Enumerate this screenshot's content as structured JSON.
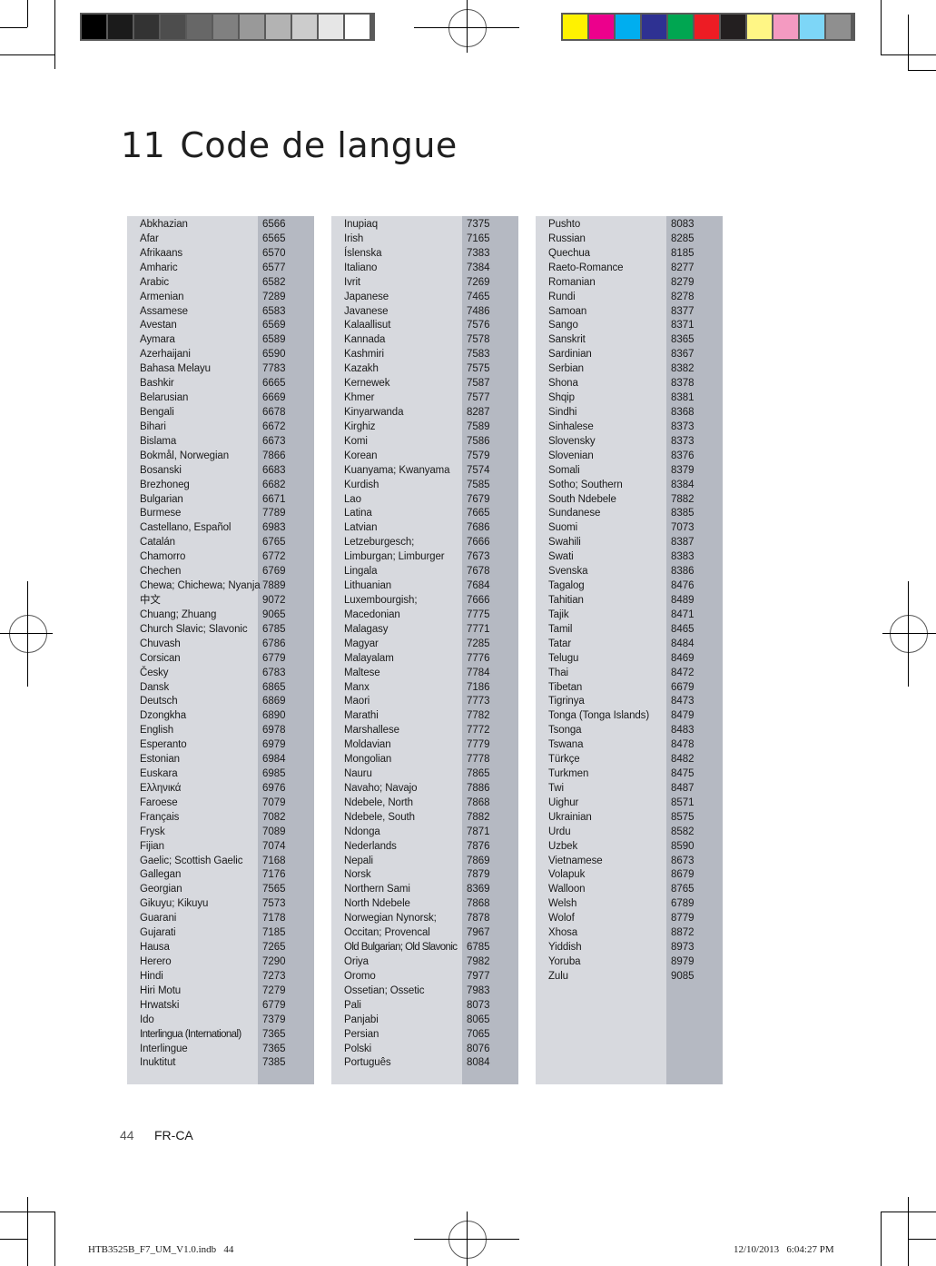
{
  "color_bars": {
    "grayscale": [
      "#000000",
      "#1b1b1b",
      "#333333",
      "#4d4d4d",
      "#676767",
      "#808080",
      "#999999",
      "#b3b3b3",
      "#cccccc",
      "#e6e6e6",
      "#ffffff"
    ],
    "process": [
      "#fff200",
      "#ec008c",
      "#00aeef",
      "#2e3192",
      "#00a651",
      "#ed1c24",
      "#231f20",
      "#fff685",
      "#f49ac1",
      "#7dd6f7",
      "#8f8f8f"
    ]
  },
  "title": {
    "number": "11",
    "text": "Code de langue"
  },
  "columns": [
    {
      "rows": [
        {
          "name": "Abkhazian",
          "code": "6566"
        },
        {
          "name": "Afar",
          "code": "6565"
        },
        {
          "name": "Afrikaans",
          "code": "6570"
        },
        {
          "name": "Amharic",
          "code": "6577"
        },
        {
          "name": "Arabic",
          "code": "6582"
        },
        {
          "name": "Armenian",
          "code": "7289"
        },
        {
          "name": "Assamese",
          "code": "6583"
        },
        {
          "name": "Avestan",
          "code": "6569"
        },
        {
          "name": "Aymara",
          "code": "6589"
        },
        {
          "name": "Azerhaijani",
          "code": "6590"
        },
        {
          "name": "Bahasa Melayu",
          "code": "7783"
        },
        {
          "name": "Bashkir",
          "code": "6665"
        },
        {
          "name": "Belarusian",
          "code": "6669"
        },
        {
          "name": "Bengali",
          "code": "6678"
        },
        {
          "name": "Bihari",
          "code": "6672"
        },
        {
          "name": "Bislama",
          "code": "6673"
        },
        {
          "name": "Bokmål, Norwegian",
          "code": "7866"
        },
        {
          "name": "Bosanski",
          "code": "6683"
        },
        {
          "name": "Brezhoneg",
          "code": "6682"
        },
        {
          "name": "Bulgarian",
          "code": "6671"
        },
        {
          "name": "Burmese",
          "code": "7789"
        },
        {
          "name": "Castellano, Español",
          "code": "6983"
        },
        {
          "name": "Catalán",
          "code": "6765"
        },
        {
          "name": "Chamorro",
          "code": "6772"
        },
        {
          "name": "Chechen",
          "code": "6769"
        },
        {
          "name": "Chewa; Chichewa; Nyanja",
          "code": "7889"
        },
        {
          "name": "中文",
          "code": "9072"
        },
        {
          "name": "Chuang; Zhuang",
          "code": "9065"
        },
        {
          "name": "Church Slavic; Slavonic",
          "code": "6785"
        },
        {
          "name": "Chuvash",
          "code": "6786"
        },
        {
          "name": "Corsican",
          "code": "6779"
        },
        {
          "name": "Česky",
          "code": "6783"
        },
        {
          "name": "Dansk",
          "code": "6865"
        },
        {
          "name": "Deutsch",
          "code": "6869"
        },
        {
          "name": "Dzongkha",
          "code": "6890"
        },
        {
          "name": "English",
          "code": "6978"
        },
        {
          "name": "Esperanto",
          "code": "6979"
        },
        {
          "name": "Estonian",
          "code": "6984"
        },
        {
          "name": "Euskara",
          "code": "6985"
        },
        {
          "name": "Ελληνικά",
          "code": "6976"
        },
        {
          "name": "Faroese",
          "code": "7079"
        },
        {
          "name": "Français",
          "code": "7082"
        },
        {
          "name": "Frysk",
          "code": "7089"
        },
        {
          "name": "Fijian",
          "code": "7074"
        },
        {
          "name": "Gaelic; Scottish Gaelic",
          "code": "7168"
        },
        {
          "name": "Gallegan",
          "code": "7176"
        },
        {
          "name": "Georgian",
          "code": "7565"
        },
        {
          "name": "Gikuyu; Kikuyu",
          "code": "7573"
        },
        {
          "name": "Guarani",
          "code": "7178"
        },
        {
          "name": "Gujarati",
          "code": "7185"
        },
        {
          "name": "Hausa",
          "code": "7265"
        },
        {
          "name": "Herero",
          "code": "7290"
        },
        {
          "name": "Hindi",
          "code": "7273"
        },
        {
          "name": "Hiri Motu",
          "code": "7279"
        },
        {
          "name": "Hrwatski",
          "code": "6779"
        },
        {
          "name": "Ido",
          "code": "7379"
        },
        {
          "name": "Interlingua (International)",
          "code": "7365"
        },
        {
          "name": "Interlingue",
          "code": "7365"
        },
        {
          "name": "Inuktitut",
          "code": "7385"
        }
      ]
    },
    {
      "rows": [
        {
          "name": "Inupiaq",
          "code": "7375"
        },
        {
          "name": "Irish",
          "code": "7165"
        },
        {
          "name": "Íslenska",
          "code": "7383"
        },
        {
          "name": "Italiano",
          "code": "7384"
        },
        {
          "name": "Ivrit",
          "code": "7269"
        },
        {
          "name": "Japanese",
          "code": "7465"
        },
        {
          "name": "Javanese",
          "code": "7486"
        },
        {
          "name": "Kalaallisut",
          "code": "7576"
        },
        {
          "name": "Kannada",
          "code": "7578"
        },
        {
          "name": "Kashmiri",
          "code": "7583"
        },
        {
          "name": "Kazakh",
          "code": "7575"
        },
        {
          "name": "Kernewek",
          "code": "7587"
        },
        {
          "name": "Khmer",
          "code": "7577"
        },
        {
          "name": "Kinyarwanda",
          "code": "8287"
        },
        {
          "name": "Kirghiz",
          "code": "7589"
        },
        {
          "name": "Komi",
          "code": "7586"
        },
        {
          "name": "Korean",
          "code": "7579"
        },
        {
          "name": "Kuanyama; Kwanyama",
          "code": "7574"
        },
        {
          "name": "Kurdish",
          "code": "7585"
        },
        {
          "name": "Lao",
          "code": "7679"
        },
        {
          "name": "Latina",
          "code": "7665"
        },
        {
          "name": "Latvian",
          "code": "7686"
        },
        {
          "name": "Letzeburgesch;",
          "code": "7666"
        },
        {
          "name": "Limburgan; Limburger",
          "code": "7673"
        },
        {
          "name": "Lingala",
          "code": "7678"
        },
        {
          "name": "Lithuanian",
          "code": "7684"
        },
        {
          "name": "Luxembourgish;",
          "code": "7666"
        },
        {
          "name": "Macedonian",
          "code": "7775"
        },
        {
          "name": "Malagasy",
          "code": "7771"
        },
        {
          "name": "Magyar",
          "code": "7285"
        },
        {
          "name": "Malayalam",
          "code": "7776"
        },
        {
          "name": "Maltese",
          "code": "7784"
        },
        {
          "name": "Manx",
          "code": "7186"
        },
        {
          "name": "Maori",
          "code": "7773"
        },
        {
          "name": "Marathi",
          "code": "7782"
        },
        {
          "name": "Marshallese",
          "code": "7772"
        },
        {
          "name": "Moldavian",
          "code": "7779"
        },
        {
          "name": "Mongolian",
          "code": "7778"
        },
        {
          "name": "Nauru",
          "code": "7865"
        },
        {
          "name": "Navaho; Navajo",
          "code": "7886"
        },
        {
          "name": "Ndebele, North",
          "code": "7868"
        },
        {
          "name": "Ndebele, South",
          "code": "7882"
        },
        {
          "name": "Ndonga",
          "code": "7871"
        },
        {
          "name": "Nederlands",
          "code": "7876"
        },
        {
          "name": "Nepali",
          "code": "7869"
        },
        {
          "name": "Norsk",
          "code": "7879"
        },
        {
          "name": "Northern Sami",
          "code": "8369"
        },
        {
          "name": "North Ndebele",
          "code": "7868"
        },
        {
          "name": "Norwegian Nynorsk;",
          "code": "7878"
        },
        {
          "name": "Occitan; Provencal",
          "code": "7967"
        },
        {
          "name": "Old Bulgarian; Old Slavonic",
          "code": "6785"
        },
        {
          "name": "Oriya",
          "code": "7982"
        },
        {
          "name": "Oromo",
          "code": "7977"
        },
        {
          "name": "Ossetian; Ossetic",
          "code": "7983"
        },
        {
          "name": "Pali",
          "code": "8073"
        },
        {
          "name": "Panjabi",
          "code": "8065"
        },
        {
          "name": "Persian",
          "code": "7065"
        },
        {
          "name": "Polski",
          "code": "8076"
        },
        {
          "name": "Português",
          "code": "8084"
        }
      ]
    },
    {
      "rows": [
        {
          "name": "Pushto",
          "code": "8083"
        },
        {
          "name": "Russian",
          "code": "8285"
        },
        {
          "name": "Quechua",
          "code": "8185"
        },
        {
          "name": "Raeto-Romance",
          "code": "8277"
        },
        {
          "name": "Romanian",
          "code": "8279"
        },
        {
          "name": "Rundi",
          "code": "8278"
        },
        {
          "name": "Samoan",
          "code": "8377"
        },
        {
          "name": "Sango",
          "code": "8371"
        },
        {
          "name": "Sanskrit",
          "code": "8365"
        },
        {
          "name": "Sardinian",
          "code": "8367"
        },
        {
          "name": "Serbian",
          "code": "8382"
        },
        {
          "name": "Shona",
          "code": "8378"
        },
        {
          "name": "Shqip",
          "code": "8381"
        },
        {
          "name": "Sindhi",
          "code": "8368"
        },
        {
          "name": "Sinhalese",
          "code": "8373"
        },
        {
          "name": "Slovensky",
          "code": "8373"
        },
        {
          "name": "Slovenian",
          "code": "8376"
        },
        {
          "name": "Somali",
          "code": "8379"
        },
        {
          "name": "Sotho; Southern",
          "code": "8384"
        },
        {
          "name": "South Ndebele",
          "code": "7882"
        },
        {
          "name": "Sundanese",
          "code": "8385"
        },
        {
          "name": "Suomi",
          "code": "7073"
        },
        {
          "name": "Swahili",
          "code": "8387"
        },
        {
          "name": "Swati",
          "code": "8383"
        },
        {
          "name": "Svenska",
          "code": "8386"
        },
        {
          "name": "Tagalog",
          "code": "8476"
        },
        {
          "name": "Tahitian",
          "code": "8489"
        },
        {
          "name": "Tajik",
          "code": "8471"
        },
        {
          "name": "Tamil",
          "code": "8465"
        },
        {
          "name": "Tatar",
          "code": "8484"
        },
        {
          "name": "Telugu",
          "code": "8469"
        },
        {
          "name": "Thai",
          "code": "8472"
        },
        {
          "name": "Tibetan",
          "code": "6679"
        },
        {
          "name": "Tigrinya",
          "code": "8473"
        },
        {
          "name": "Tonga (Tonga Islands)",
          "code": "8479"
        },
        {
          "name": "Tsonga",
          "code": "8483"
        },
        {
          "name": "Tswana",
          "code": "8478"
        },
        {
          "name": "Türkçe",
          "code": "8482"
        },
        {
          "name": "Turkmen",
          "code": "8475"
        },
        {
          "name": "Twi",
          "code": "8487"
        },
        {
          "name": "Uighur",
          "code": "8571"
        },
        {
          "name": "Ukrainian",
          "code": "8575"
        },
        {
          "name": "Urdu",
          "code": "8582"
        },
        {
          "name": "Uzbek",
          "code": "8590"
        },
        {
          "name": "Vietnamese",
          "code": "8673"
        },
        {
          "name": "Volapuk",
          "code": "8679"
        },
        {
          "name": "Walloon",
          "code": "8765"
        },
        {
          "name": "Welsh",
          "code": "6789"
        },
        {
          "name": "Wolof",
          "code": "8779"
        },
        {
          "name": "Xhosa",
          "code": "8872"
        },
        {
          "name": "Yiddish",
          "code": "8973"
        },
        {
          "name": "Yoruba",
          "code": "8979"
        },
        {
          "name": "Zulu",
          "code": "9085"
        }
      ]
    }
  ],
  "footer": {
    "page_number": "44",
    "locale": "FR-CA"
  },
  "slug": {
    "file": "HTB3525B_F7_UM_V1.0.indb   44",
    "datetime": "12/10/2013   6:04:27 PM"
  }
}
